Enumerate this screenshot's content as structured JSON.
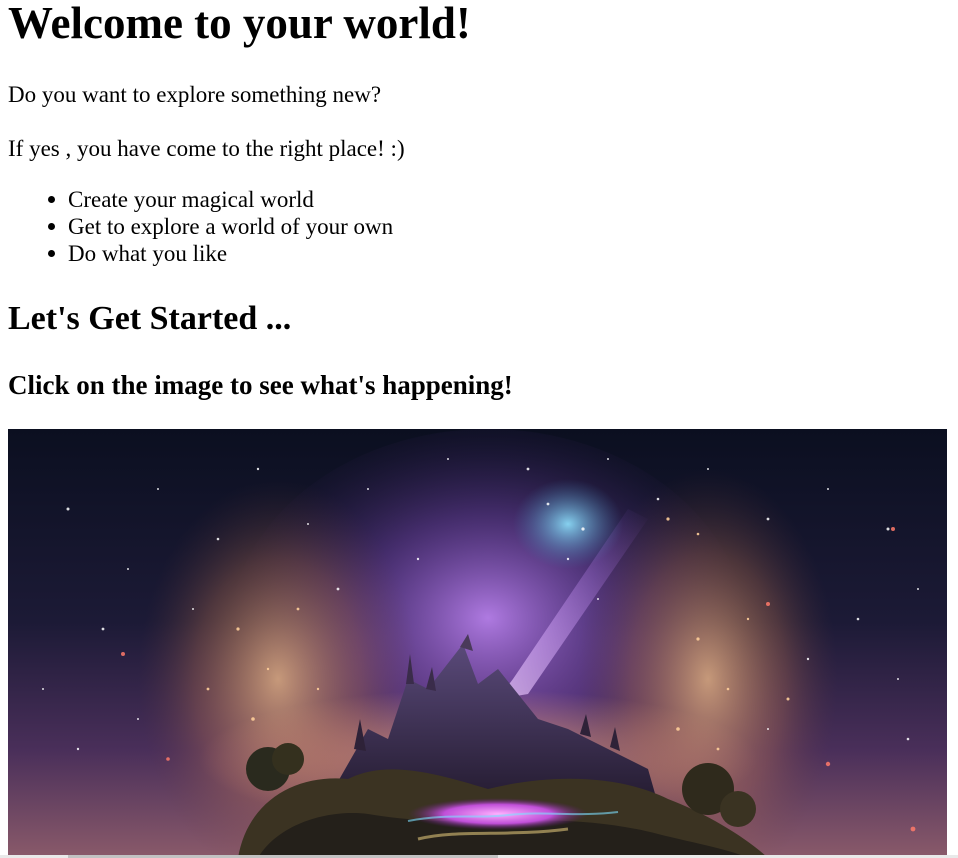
{
  "header": {
    "title": "Welcome to your world!"
  },
  "intro": {
    "question": "Do you want to explore something new?",
    "answer": "If yes , you have come to the right place! :)"
  },
  "features": [
    "Create your magical world",
    "Get to explore a world of your own",
    "Do what you like"
  ],
  "cta": {
    "heading": "Let's Get Started ...",
    "instruction": "Click on the image to see what's happening!"
  },
  "image": {
    "subject": "magical-world-castle-icon",
    "colors": {
      "sky_top": "#0b0f20",
      "sky_mid": "#2a1f45",
      "glow_purple": "#b46bff",
      "glow_orange": "#f3a86a",
      "mountain": "#2b1f3a",
      "ground": "#3b3322"
    }
  },
  "colors": {
    "text": "#000000",
    "background": "#ffffff"
  }
}
